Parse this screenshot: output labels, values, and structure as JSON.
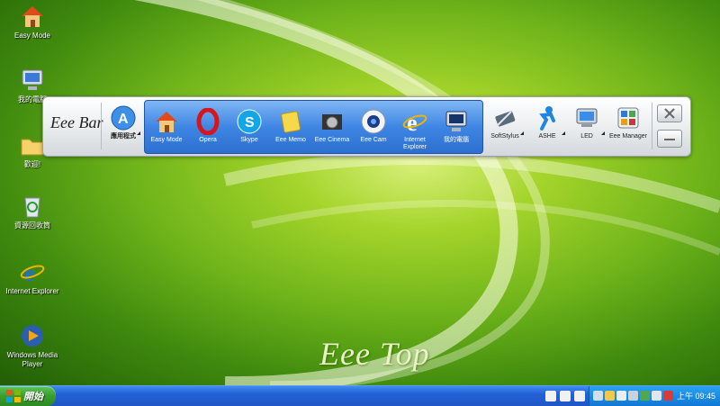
{
  "desktop": {
    "icons": [
      {
        "label": "Easy Mode",
        "icon": "house-icon"
      },
      {
        "label": "我的電腦",
        "icon": "computer-icon"
      },
      {
        "label": "歡迎!",
        "icon": "folder-icon"
      },
      {
        "label": "資源回收筒",
        "icon": "recycle-bin-icon"
      },
      {
        "label": "Internet Explorer",
        "icon": "internet-explorer-icon"
      },
      {
        "label": "Windows Media Player",
        "icon": "media-player-icon"
      }
    ],
    "watermark": "Eee Top"
  },
  "eeebar": {
    "logo": "Eee Bar",
    "apps_menu": {
      "label": "應用程式",
      "icon": "apps-menu-icon"
    },
    "items": [
      {
        "label": "Easy Mode",
        "icon": "house-icon"
      },
      {
        "label": "Opera",
        "icon": "opera-icon"
      },
      {
        "label": "Skype",
        "icon": "skype-icon"
      },
      {
        "label": "Eee Memo",
        "icon": "memo-icon"
      },
      {
        "label": "Eee Cinema",
        "icon": "cinema-icon"
      },
      {
        "label": "Eee Cam",
        "icon": "camera-icon"
      },
      {
        "label": "Internet Explorer",
        "icon": "internet-explorer-icon"
      },
      {
        "label": "我的電腦",
        "icon": "computer-icon"
      }
    ],
    "tools": [
      {
        "label": "SoftStylus",
        "icon": "stylus-icon"
      },
      {
        "label": "ASHE",
        "icon": "ashe-icon"
      },
      {
        "label": "LED",
        "icon": "led-icon"
      },
      {
        "label": "Eee Manager",
        "icon": "manager-icon"
      }
    ]
  },
  "taskbar": {
    "start_label": "開始",
    "clock": "上午 09:45"
  },
  "colors": {
    "taskbar": "#2461d6",
    "start": "#3a9c2e",
    "group": "#3f86e4",
    "tray": "#1786e0"
  }
}
